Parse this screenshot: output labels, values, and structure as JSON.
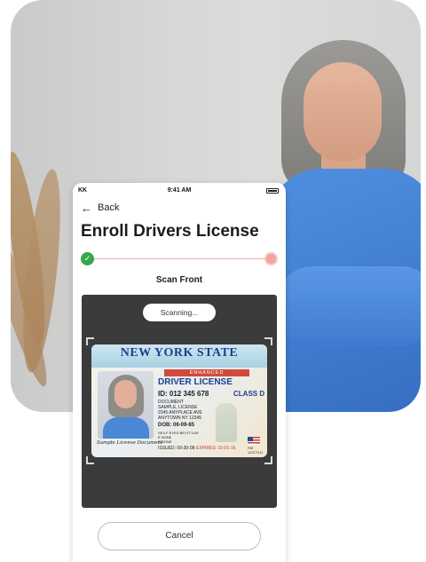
{
  "status_bar": {
    "carrier": "KK",
    "time": "9:41 AM"
  },
  "nav": {
    "back_label": "Back"
  },
  "page": {
    "title": "Enroll Drivers License"
  },
  "stepper": {
    "current_step": 1,
    "total_steps": 2
  },
  "scan": {
    "label": "Scan Front",
    "status": "Scanning..."
  },
  "license": {
    "state": "NEW YORK STATE",
    "enhanced": "ENHANCED",
    "type": "DRIVER LICENSE",
    "id": "ID: 012 345 678",
    "class": "CLASS D",
    "lines": [
      "DOCUMENT",
      "SAMPLE, LICENSE",
      "2345 ANYPLACE AVE",
      "ANYTOWN NY 12345"
    ],
    "dob": "DOB: 06-09-85",
    "details": [
      "SEX F  EYES BR  HT 5-09",
      "E NONE",
      "R NONE"
    ],
    "issued": "ISSUED: 09-30-08",
    "expires": "EXPIRES: 10-01-16",
    "signature": "Sample License Document",
    "serial": "RM 12377011"
  },
  "actions": {
    "cancel_label": "Cancel"
  },
  "colors": {
    "step_done": "#37a84b",
    "step_todo": "#f4a29c",
    "scanner_bg": "#3b3b3b",
    "shirt_blue": "#4a87d6"
  }
}
